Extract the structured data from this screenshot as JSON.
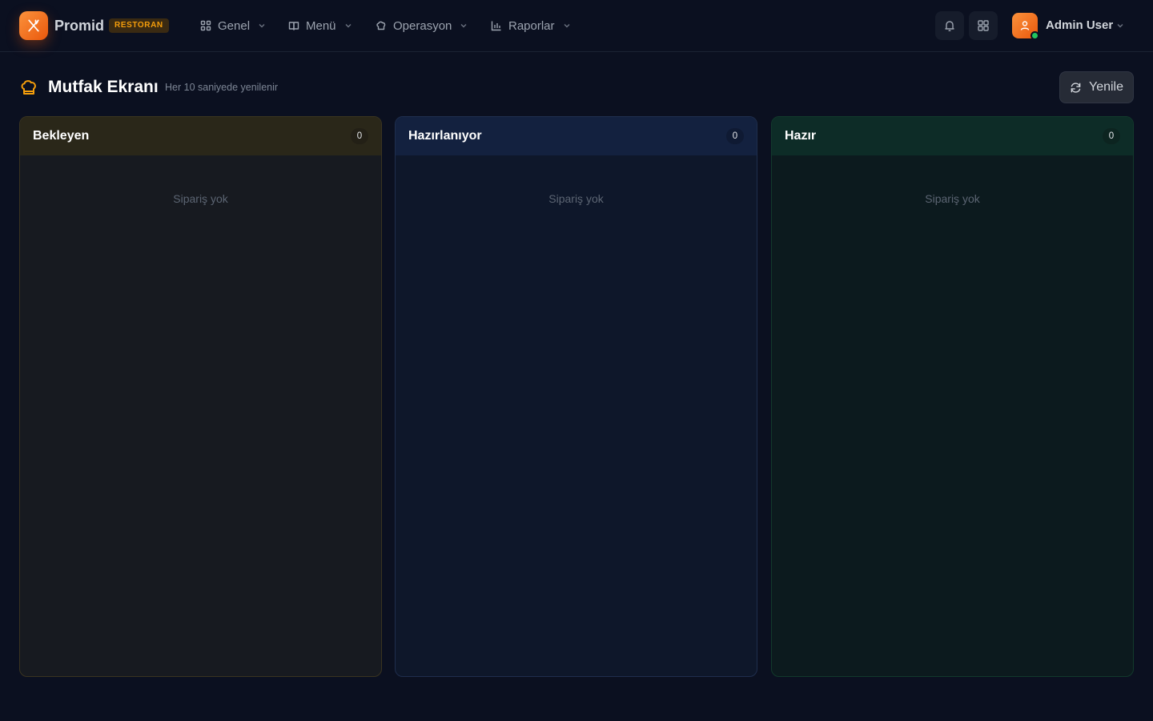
{
  "app": {
    "brand": "Promid",
    "badge": "RESTORAN"
  },
  "nav": {
    "items": [
      {
        "label": "Genel",
        "icon": "grid-icon"
      },
      {
        "label": "Menü",
        "icon": "book-icon"
      },
      {
        "label": "Operasyon",
        "icon": "chef-hat-icon"
      },
      {
        "label": "Raporlar",
        "icon": "bar-chart-icon"
      }
    ]
  },
  "user": {
    "name": "Admin User",
    "status": "online"
  },
  "page": {
    "title": "Mutfak Ekranı",
    "subtitle": "Her 10 saniyede yenilenir",
    "refresh_label": "Yenile"
  },
  "columns": [
    {
      "title": "Bekleyen",
      "count": "0",
      "empty_text": "Sipariş yok",
      "accent": "#f59e0b"
    },
    {
      "title": "Hazırlanıyor",
      "count": "0",
      "empty_text": "Sipariş yok",
      "accent": "#3b82f6"
    },
    {
      "title": "Hazır",
      "count": "0",
      "empty_text": "Sipariş yok",
      "accent": "#10b981"
    }
  ],
  "colors": {
    "brand": "#f97316",
    "background": "#0b1020"
  }
}
